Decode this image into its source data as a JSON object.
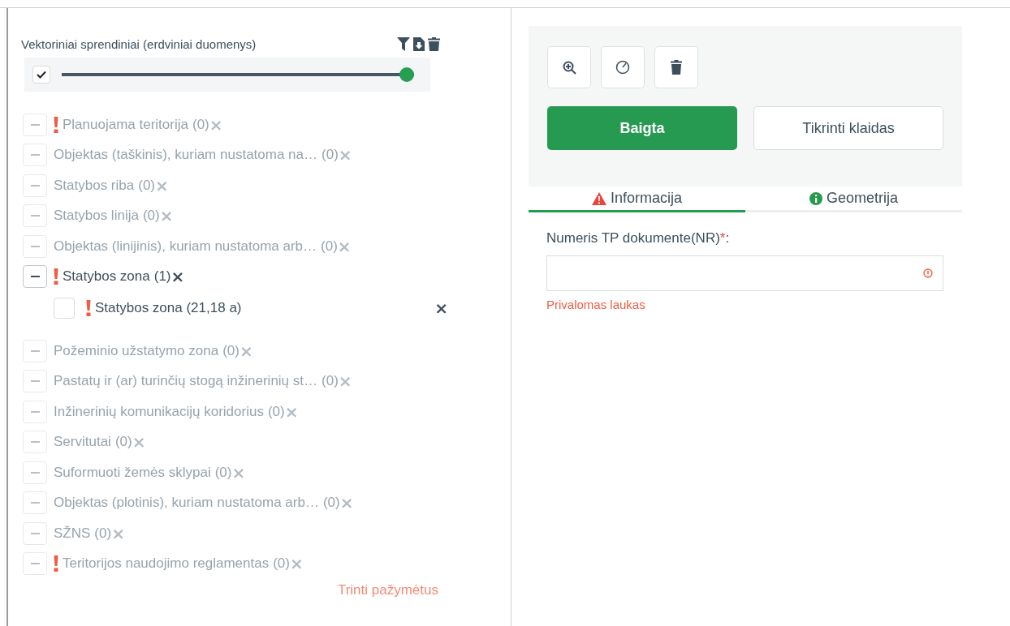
{
  "layers_panel": {
    "title": "Vektoriniai sprendiniai (erdviniai duomenys)",
    "toggle": {
      "checked": true,
      "level": 1
    },
    "layers": [
      {
        "label": "Planuojama teritorija",
        "count": "(0)",
        "required": true,
        "active": false,
        "remove": "×"
      },
      {
        "label": "Objektas (taškinis), kuriam nustatoma na…",
        "count": "(0)",
        "required": false,
        "active": false,
        "remove": "×"
      },
      {
        "label": "Statybos riba",
        "count": "(0)",
        "required": false,
        "active": false,
        "remove": "×"
      },
      {
        "label": "Statybos linija",
        "count": "(0)",
        "required": false,
        "active": false,
        "remove": "×"
      },
      {
        "label": "Objektas (linijinis), kuriam nustatoma arb…",
        "count": "(0)",
        "required": false,
        "active": false,
        "remove": "×"
      },
      {
        "label": "Statybos zona",
        "count": "(1)",
        "required": true,
        "active": true,
        "remove": "×",
        "children": [
          {
            "label": "Statybos zona (21,18 a)",
            "required": true,
            "checked": false,
            "remove": "×"
          }
        ]
      },
      {
        "label": "Požeminio užstatymo zona",
        "count": "(0)",
        "required": false,
        "active": false,
        "remove": "×"
      },
      {
        "label": "Pastatų ir (ar) turinčių stogą inžinerinių st…",
        "count": "(0)",
        "required": false,
        "active": false,
        "remove": "×"
      },
      {
        "label": "Inžinerinių komunikacijų koridorius",
        "count": "(0)",
        "required": false,
        "active": false,
        "remove": "×"
      },
      {
        "label": "Servitutai",
        "count": "(0)",
        "required": false,
        "active": false,
        "remove": "×"
      },
      {
        "label": "Suformuoti žemės sklypai",
        "count": "(0)",
        "required": false,
        "active": false,
        "remove": "×"
      },
      {
        "label": "Objektas (plotinis), kuriam nustatoma arb…",
        "count": "(0)",
        "required": false,
        "active": false,
        "remove": "×"
      },
      {
        "label": "SŽNS",
        "count": "(0)",
        "required": false,
        "active": false,
        "remove": "×"
      },
      {
        "label": "Teritorijos naudojimo reglamentas",
        "count": "(0)",
        "required": true,
        "active": false,
        "remove": "×"
      }
    ],
    "delete_selected": "Trinti pažymėtus"
  },
  "editor": {
    "primary_button": "Baigta",
    "secondary_button": "Tikrinti klaidas",
    "tabs": [
      {
        "label": "Informacija",
        "kind": "warning",
        "selected": true
      },
      {
        "label": "Geometrija",
        "kind": "info",
        "selected": false
      }
    ],
    "field": {
      "label": "Numeris TP dokumente(NR)",
      "mark": "*",
      "suffix": ":",
      "error": "Privalomas laukas"
    }
  }
}
